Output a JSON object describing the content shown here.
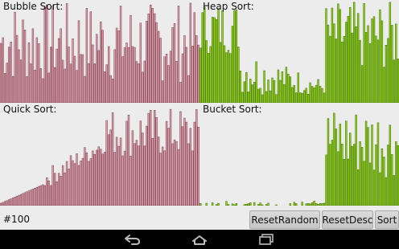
{
  "panels": {
    "bubble": {
      "title": "Bubble Sort:"
    },
    "heap": {
      "title": "Heap Sort:"
    },
    "quick": {
      "title": "Quick Sort:"
    },
    "bucket": {
      "title": "Bucket Sort:"
    }
  },
  "controls": {
    "count": "#100",
    "reset_random": "ResetRandom",
    "reset_desc": "ResetDesc",
    "sort": "Sort"
  },
  "nav": {
    "back_icon": "back-arrow-icon",
    "home_icon": "home-icon",
    "recent_icon": "recent-apps-icon"
  },
  "colors": {
    "pink_bar": "#dba6b1",
    "pink_edge": "#7a3344",
    "green_bar": "#8fd21a",
    "green_edge": "#3f6a00",
    "background": "#ececec"
  }
}
